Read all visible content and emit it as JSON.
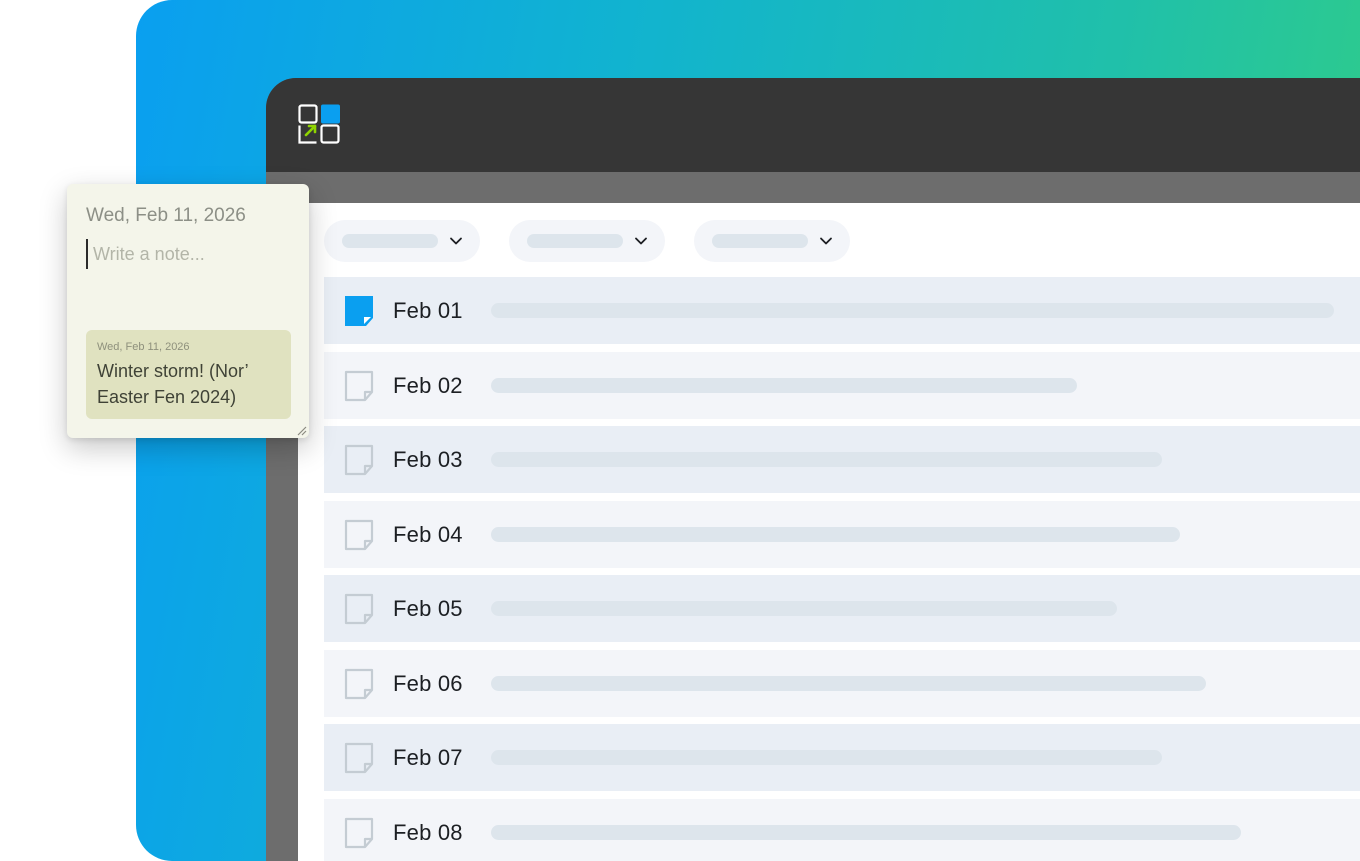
{
  "note_popup": {
    "date": "Wed, Feb 11, 2026",
    "placeholder": "Write a note...",
    "value": "",
    "saved_notes": [
      {
        "date": "Wed, Feb 11, 2026",
        "text": "Winter storm! (Nor’ Easter Fen 2024)"
      }
    ]
  },
  "filters": [
    {
      "icon": "chevron-down-icon"
    },
    {
      "icon": "chevron-down-icon"
    },
    {
      "icon": "chevron-down-icon"
    }
  ],
  "dates": [
    {
      "label": "Feb 01",
      "has_note": true,
      "bar_fraction": 1.0
    },
    {
      "label": "Feb 02",
      "has_note": false,
      "bar_fraction": 0.695
    },
    {
      "label": "Feb 03",
      "has_note": false,
      "bar_fraction": 0.796
    },
    {
      "label": "Feb 04",
      "has_note": false,
      "bar_fraction": 0.817
    },
    {
      "label": "Feb 05",
      "has_note": false,
      "bar_fraction": 0.742
    },
    {
      "label": "Feb 06",
      "has_note": false,
      "bar_fraction": 0.848
    },
    {
      "label": "Feb 07",
      "has_note": false,
      "bar_fraction": 0.796
    },
    {
      "label": "Feb 08",
      "has_note": false,
      "bar_fraction": 0.89
    }
  ],
  "colors": {
    "accent": "#0a9ff0",
    "logo_arrow": "#8fd400",
    "header": "#363636",
    "note_bg": "#f4f5ea",
    "saved_note_bg": "#e0e2c0"
  }
}
